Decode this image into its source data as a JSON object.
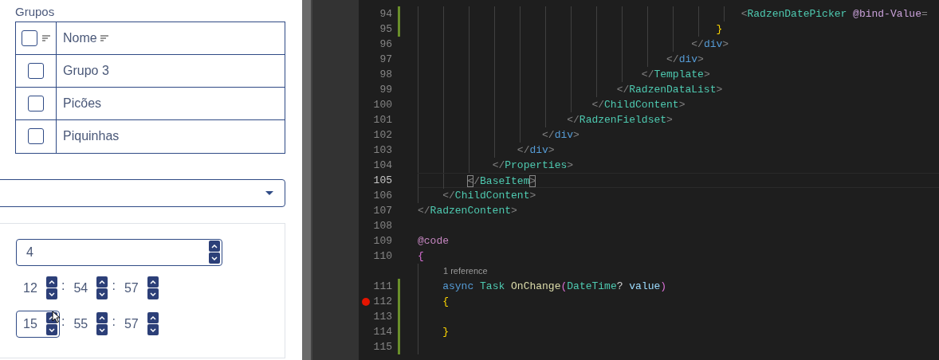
{
  "groups": {
    "label": "Grupos",
    "header": {
      "checked": false,
      "column": "Nome"
    },
    "rows": [
      {
        "name": "Grupo 3",
        "checked": false
      },
      {
        "name": "Picões",
        "checked": false
      },
      {
        "name": "Piquinhas",
        "checked": false
      }
    ]
  },
  "number_field": {
    "value": "4"
  },
  "time_rows": [
    {
      "parts": [
        "12",
        "54",
        "57"
      ],
      "separator": ":",
      "focused": false
    },
    {
      "parts": [
        "15",
        "55",
        "57"
      ],
      "separator": ":",
      "focused": true
    }
  ],
  "editor": {
    "lines": [
      {
        "number": "94",
        "changed": true,
        "current": false,
        "breakpoint": false,
        "tokens": [
          {
            "text": "                                                    <",
            "kind": "punct"
          },
          {
            "text": "RadzenDatePicker",
            "kind": "tag"
          },
          {
            "text": " @bind-Value",
            "kind": "attr"
          },
          {
            "text": "=",
            "kind": "punct"
          }
        ]
      },
      {
        "number": "95",
        "changed": true,
        "current": false,
        "breakpoint": false,
        "tokens": [
          {
            "text": "                                                }",
            "kind": "brace"
          }
        ]
      },
      {
        "number": "96",
        "changed": false,
        "current": false,
        "breakpoint": false,
        "tokens": [
          {
            "text": "                                            </",
            "kind": "punct"
          },
          {
            "text": "div",
            "kind": "html"
          },
          {
            "text": ">",
            "kind": "punct"
          }
        ]
      },
      {
        "number": "97",
        "changed": false,
        "current": false,
        "breakpoint": false,
        "tokens": [
          {
            "text": "                                        </",
            "kind": "punct"
          },
          {
            "text": "div",
            "kind": "html"
          },
          {
            "text": ">",
            "kind": "punct"
          }
        ]
      },
      {
        "number": "98",
        "changed": false,
        "current": false,
        "breakpoint": false,
        "tokens": [
          {
            "text": "                                    </",
            "kind": "punct"
          },
          {
            "text": "Template",
            "kind": "tag"
          },
          {
            "text": ">",
            "kind": "punct"
          }
        ]
      },
      {
        "number": "99",
        "changed": false,
        "current": false,
        "breakpoint": false,
        "tokens": [
          {
            "text": "                                </",
            "kind": "punct"
          },
          {
            "text": "RadzenDataList",
            "kind": "tag"
          },
          {
            "text": ">",
            "kind": "punct"
          }
        ]
      },
      {
        "number": "100",
        "changed": false,
        "current": false,
        "breakpoint": false,
        "tokens": [
          {
            "text": "                            </",
            "kind": "punct"
          },
          {
            "text": "ChildContent",
            "kind": "tag"
          },
          {
            "text": ">",
            "kind": "punct"
          }
        ]
      },
      {
        "number": "101",
        "changed": false,
        "current": false,
        "breakpoint": false,
        "tokens": [
          {
            "text": "                        </",
            "kind": "punct"
          },
          {
            "text": "RadzenFieldset",
            "kind": "tag"
          },
          {
            "text": ">",
            "kind": "punct"
          }
        ]
      },
      {
        "number": "102",
        "changed": false,
        "current": false,
        "breakpoint": false,
        "tokens": [
          {
            "text": "                    </",
            "kind": "punct"
          },
          {
            "text": "div",
            "kind": "html"
          },
          {
            "text": ">",
            "kind": "punct"
          }
        ]
      },
      {
        "number": "103",
        "changed": false,
        "current": false,
        "breakpoint": false,
        "tokens": [
          {
            "text": "                </",
            "kind": "punct"
          },
          {
            "text": "div",
            "kind": "html"
          },
          {
            "text": ">",
            "kind": "punct"
          }
        ]
      },
      {
        "number": "104",
        "changed": false,
        "current": false,
        "breakpoint": false,
        "tokens": [
          {
            "text": "            </",
            "kind": "punct"
          },
          {
            "text": "Properties",
            "kind": "tag"
          },
          {
            "text": ">",
            "kind": "punct"
          }
        ]
      },
      {
        "number": "105",
        "changed": false,
        "current": true,
        "breakpoint": false,
        "tokens": [
          {
            "text": "        <",
            "kind": "match"
          },
          {
            "text": "/",
            "kind": "punct"
          },
          {
            "text": "BaseItem",
            "kind": "tag"
          },
          {
            "text": ">",
            "kind": "match"
          }
        ]
      },
      {
        "number": "106",
        "changed": false,
        "current": false,
        "breakpoint": false,
        "tokens": [
          {
            "text": "    </",
            "kind": "punct"
          },
          {
            "text": "ChildContent",
            "kind": "tag"
          },
          {
            "text": ">",
            "kind": "punct"
          }
        ]
      },
      {
        "number": "107",
        "changed": false,
        "current": false,
        "breakpoint": false,
        "tokens": [
          {
            "text": "</",
            "kind": "punct"
          },
          {
            "text": "RadzenContent",
            "kind": "tag"
          },
          {
            "text": ">",
            "kind": "punct"
          }
        ]
      },
      {
        "number": "108",
        "changed": false,
        "current": false,
        "breakpoint": false
      },
      {
        "number": "109",
        "changed": false,
        "current": false,
        "breakpoint": false,
        "tokens": [
          {
            "text": "@code",
            "kind": "razor"
          }
        ]
      },
      {
        "number": "110",
        "changed": false,
        "current": false,
        "breakpoint": false,
        "tokens": [
          {
            "text": "{",
            "kind": "brace2"
          }
        ]
      },
      {
        "number": "111",
        "codelens": "1 reference",
        "changed": true,
        "current": false,
        "breakpoint": false,
        "tokens": [
          {
            "text": "    async",
            "kind": "keyword"
          },
          {
            "text": " Task",
            "kind": "tag"
          },
          {
            "text": " OnChange",
            "kind": "method"
          },
          {
            "text": "(",
            "kind": "brace2"
          },
          {
            "text": "DateTime",
            "kind": "tag"
          },
          {
            "text": "?",
            "kind": "plain"
          },
          {
            "text": " value",
            "kind": "param"
          },
          {
            "text": ")",
            "kind": "brace2"
          }
        ]
      },
      {
        "number": "112",
        "changed": true,
        "current": false,
        "breakpoint": true,
        "tokens": [
          {
            "text": "    {",
            "kind": "brace"
          }
        ]
      },
      {
        "number": "113",
        "changed": true,
        "current": false,
        "breakpoint": false
      },
      {
        "number": "114",
        "changed": true,
        "current": false,
        "breakpoint": false,
        "tokens": [
          {
            "text": "    }",
            "kind": "brace"
          }
        ]
      },
      {
        "number": "115",
        "changed": true,
        "current": false,
        "breakpoint": false
      }
    ]
  }
}
